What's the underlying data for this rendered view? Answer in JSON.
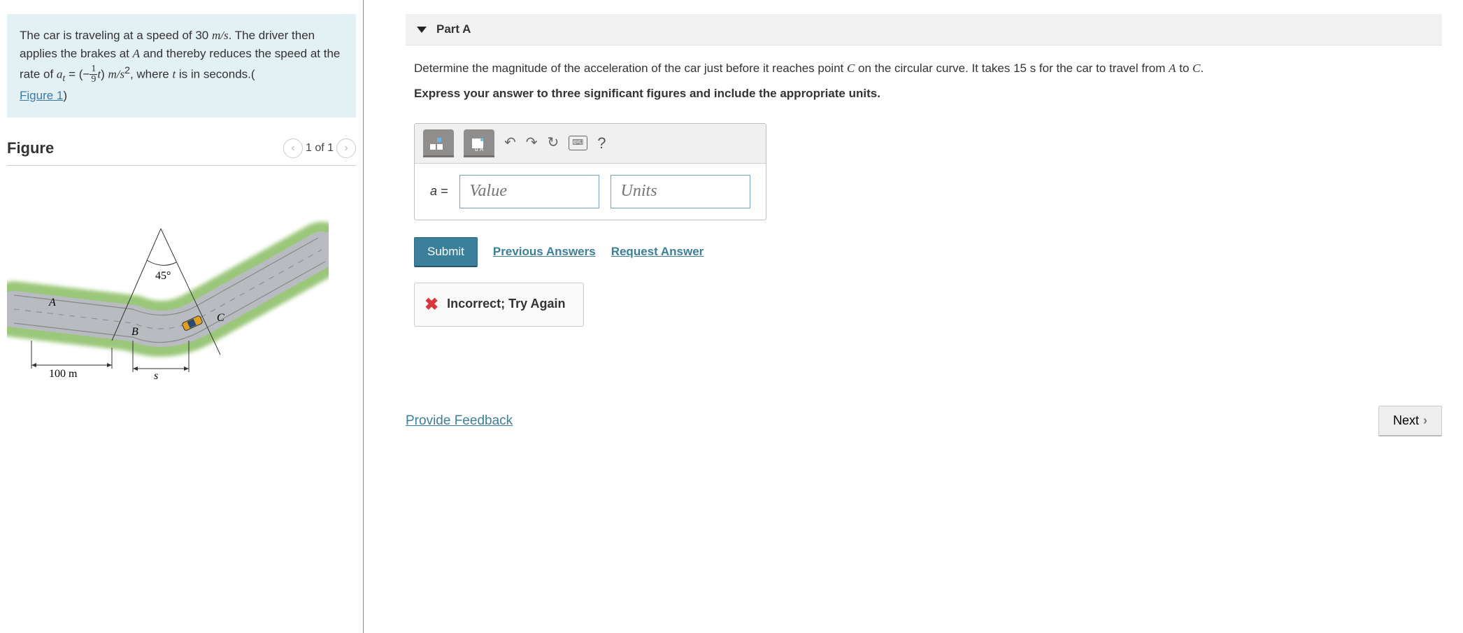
{
  "left": {
    "problem_html_1": "The car is traveling at a speed of 30 ",
    "problem_units1": "m/s",
    "problem_html_2": ". The driver then applies the brakes at ",
    "problem_A": "A",
    "problem_html_3": " and thereby reduces the speed at the rate of ",
    "at_label": "a",
    "at_sub": "t",
    "eq": " = (−",
    "frac_n": "1",
    "frac_d": "9",
    "t_var": "t",
    "closep": ") ",
    "units2": "m/s",
    "sq": "2",
    "problem_html_4": ", where ",
    "t2": "t",
    "problem_html_5": " is in seconds.(",
    "fig_link": "Figure 1",
    "closeparen": ")",
    "figure_heading": "Figure",
    "pager_text": "1 of 1",
    "figure_labels": {
      "angle": "45°",
      "A": "A",
      "B": "B",
      "C": "C",
      "s": "s",
      "dist": "100 m"
    }
  },
  "right": {
    "part_label": "Part A",
    "question_p1a": "Determine the magnitude of the acceleration of the car just before it reaches point ",
    "C": "C",
    "question_p1b": " on the circular curve. It takes 15 s for the car to travel from ",
    "A": "A",
    "to": " to ",
    "C2": "C",
    "period": ".",
    "instructions": "Express your answer to three significant figures and include the appropriate units.",
    "lhs": "a =",
    "value_ph": "Value",
    "units_ph": "Units",
    "submit": "Submit",
    "prev_answers": "Previous Answers",
    "req_answer": "Request Answer",
    "feedback": "Incorrect; Try Again",
    "provide": "Provide Feedback",
    "next": "Next"
  }
}
